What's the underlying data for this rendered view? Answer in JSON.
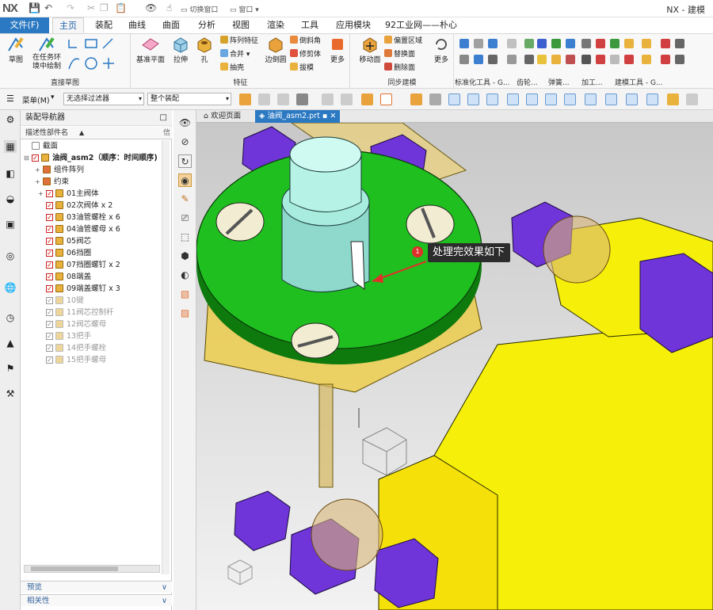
{
  "titlebar": {
    "logo": "NX",
    "switch_window": "切换窗口",
    "window": "窗口",
    "app_title": "NX - 建模"
  },
  "ribbon_tabs": [
    "文件(F)",
    "主页",
    "装配",
    "曲线",
    "曲面",
    "分析",
    "视图",
    "渲染",
    "工具",
    "应用模块",
    "92工业网——朴心"
  ],
  "groups": {
    "direct_sketch": {
      "label": "直接草图",
      "sketch": "草图",
      "in_task": "在任务环境中绘制"
    },
    "feature": {
      "label": "特征",
      "datum": "基准平面",
      "extrude": "拉伸",
      "hole": "孔",
      "pattern": "阵列特征",
      "unite": "合并",
      "shell": "抽壳",
      "edge_blend": "边倒圆",
      "chamfer": "倒斜角",
      "trim": "修剪体",
      "draft": "拔模",
      "more": "更多"
    },
    "sync": {
      "label": "同步建模",
      "move_face": "移动面",
      "offset_region": "偏置区域",
      "replace_face": "替换面",
      "delete_face": "删除面",
      "more": "更多"
    },
    "small_labels": [
      "标准化工具 - G...",
      "齿轮...",
      "弹簧...",
      "加工...",
      "建模工具 - G..."
    ]
  },
  "toolbar2": {
    "menu": "菜单(M)",
    "filter": "无选择过滤器",
    "scope": "整个装配"
  },
  "navigator": {
    "title": "装配导航器",
    "column": "描述性部件名",
    "rows": [
      {
        "label": "截面",
        "type": "folder",
        "grey": false
      },
      {
        "label": "油阀_asm2（顺序：时间顺序)",
        "type": "root",
        "grey": false
      },
      {
        "label": "组件阵列",
        "type": "sub",
        "grey": false
      },
      {
        "label": "约束",
        "type": "sub",
        "grey": false
      },
      {
        "label": "01主阀体",
        "type": "part",
        "grey": false
      },
      {
        "label": "02次阀体 x 2",
        "type": "part",
        "grey": false
      },
      {
        "label": "03油管螺栓 x 6",
        "type": "part",
        "grey": false
      },
      {
        "label": "04油管螺母 x 6",
        "type": "part",
        "grey": false
      },
      {
        "label": "05阀芯",
        "type": "part",
        "grey": false
      },
      {
        "label": "06挡圈",
        "type": "part",
        "grey": false
      },
      {
        "label": "07挡圈螺钉 x 2",
        "type": "part",
        "grey": false
      },
      {
        "label": "08端盖",
        "type": "part",
        "grey": false
      },
      {
        "label": "09端盖螺钉 x 3",
        "type": "part",
        "grey": false
      },
      {
        "label": "10键",
        "type": "part",
        "grey": true
      },
      {
        "label": "11阀芯控制杆",
        "type": "part",
        "grey": true
      },
      {
        "label": "12阀芯螺母",
        "type": "part",
        "grey": true
      },
      {
        "label": "13把手",
        "type": "part",
        "grey": true
      },
      {
        "label": "14把手螺栓",
        "type": "part",
        "grey": true
      },
      {
        "label": "15把手螺母",
        "type": "part",
        "grey": true
      }
    ],
    "preview": "预览",
    "dependencies": "相关性"
  },
  "doc_tabs": {
    "welcome": "欢迎页面",
    "active": "油阀_asm2.prt"
  },
  "callout": {
    "number": "1",
    "text": "处理完效果如下"
  },
  "colors": {
    "accent": "#2b79c2",
    "green": "#1fbf1f",
    "yellow": "#f5ef0a",
    "purple": "#7a3fe0"
  }
}
